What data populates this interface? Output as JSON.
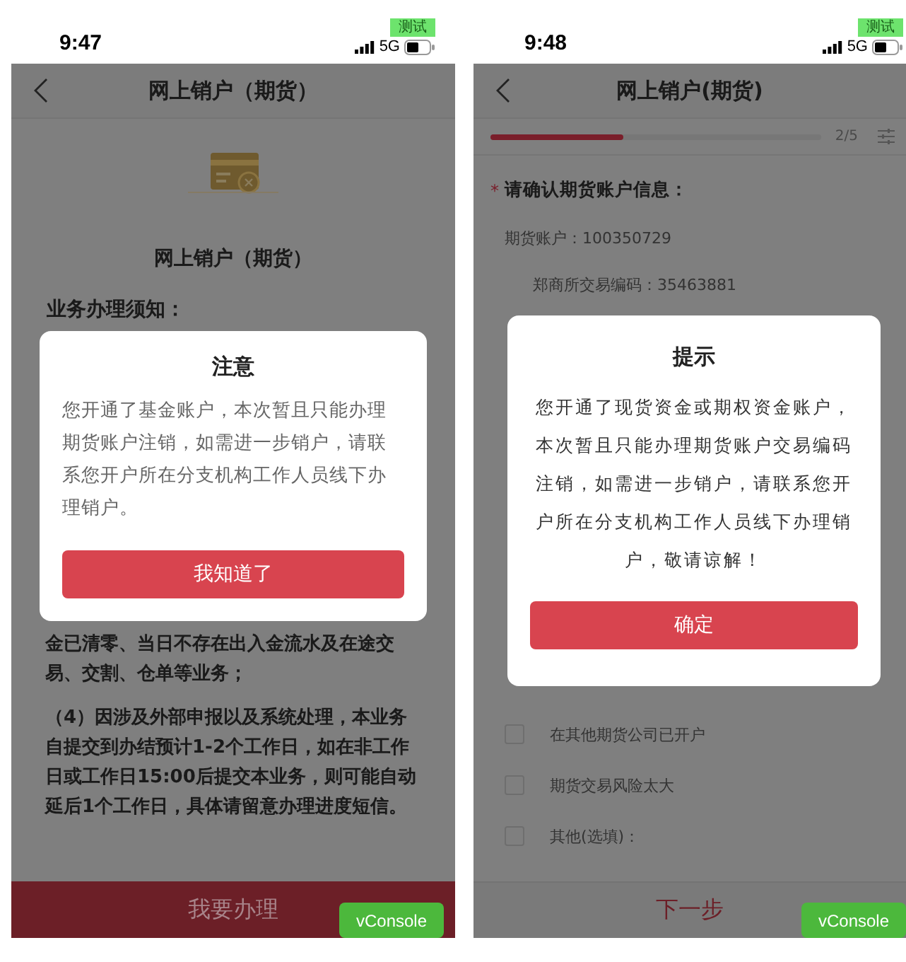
{
  "left_screen": {
    "status_bar": {
      "time": "9:47",
      "badge": "测试",
      "network": "5G"
    },
    "nav_title": "网上销户（期货）",
    "page_title": "网上销户（期货）",
    "notice_heading": "业务办理须知：",
    "dialog": {
      "title": "注意",
      "message": "您开通了基金账户，本次暂且只能办理期货账户注销，如需进一步销户，请联系您开户所在分支机构工作人员线下办理销户。",
      "button": "我知道了"
    },
    "notice_paragraphs": [
      "金已清零、当日不存在出入金流水及在途交易、交割、仓单等业务；",
      "（4）因涉及外部申报以及系统处理，本业务自提交到办结预计1-2个工作日，如在非工作日或工作日15:00后提交本业务，则可能自动延后1个工作日，具体请留意办理进度短信。"
    ],
    "primary_button": "我要办理",
    "vconsole": "vConsole"
  },
  "right_screen": {
    "status_bar": {
      "time": "9:48",
      "badge": "测试",
      "network": "5G"
    },
    "nav_title": "网上销户(期货)",
    "progress": {
      "level": 0.4,
      "reading": "2/5"
    },
    "required_mark": "*",
    "section_heading": "请确认期货账户信息：",
    "fields": [
      "期货账户：100350729",
      "郑商所交易编码：35463881"
    ],
    "dialog": {
      "title": "提示",
      "message": "您开通了现货资金或期权资金账户，本次暂且只能办理期货账户交易编码注销，如需进一步销户，请联系您开户所在分支机构工作人员线下办理销户，敬请谅解！",
      "button": "确定"
    },
    "options": [
      {
        "label": "在其他期货公司已开户",
        "checked": false
      },
      {
        "label": "期货交易风险太大",
        "checked": false
      },
      {
        "label": "其他(选填)：",
        "checked": false
      }
    ],
    "next_button": "下一步",
    "vconsole": "vConsole"
  }
}
